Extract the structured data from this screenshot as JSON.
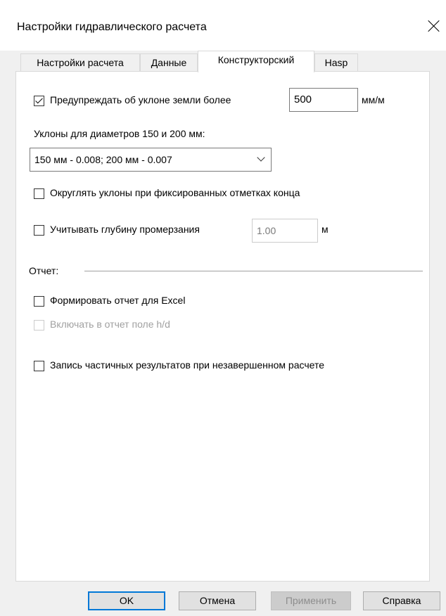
{
  "window": {
    "title": "Настройки гидравлического расчета"
  },
  "tabs": [
    {
      "label": "Настройки расчета"
    },
    {
      "label": "Данные"
    },
    {
      "label": "Конструкторский"
    },
    {
      "label": "Hasp"
    }
  ],
  "active_tab": "Конструкторский",
  "design": {
    "warn_slope": {
      "label": "Предупреждать об уклоне земли более",
      "checked": true,
      "value": "500",
      "unit": "мм/м"
    },
    "slopes_label": "Уклоны для диаметров 150 и 200 мм:",
    "slopes_select": {
      "value": "150 мм - 0.008; 200 мм - 0.007"
    },
    "round_slopes": {
      "label": "Округлять уклоны при фиксированных отметках конца",
      "checked": false
    },
    "freeze_depth": {
      "label": "Учитывать глубину промерзания",
      "checked": false,
      "value": "1.00",
      "unit": "м"
    },
    "report_section": "Отчет:",
    "excel_report": {
      "label": "Формировать отчет для Excel",
      "checked": false
    },
    "include_hd": {
      "label": "Включать в отчет поле h/d",
      "checked": false,
      "enabled": false
    },
    "partial_results": {
      "label": "Запись частичных результатов при незавершенном расчете",
      "checked": false
    }
  },
  "buttons": {
    "ok": "OK",
    "cancel": "Отмена",
    "apply": "Применить",
    "help": "Справка"
  },
  "colors": {
    "default_button_border": "#0078d7",
    "disabled_text": "#a0a0a0"
  }
}
